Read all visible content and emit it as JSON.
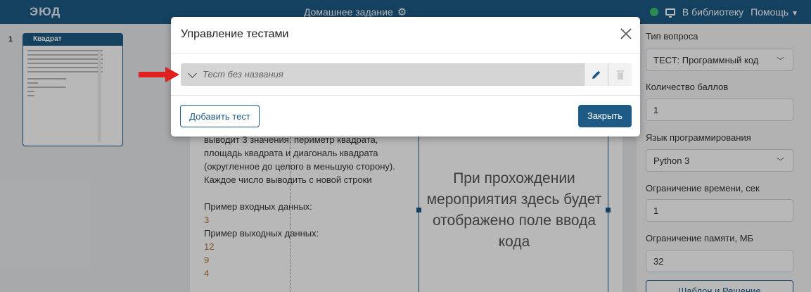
{
  "topbar": {
    "logo": "ЭЮД",
    "title": "Домашнее задание",
    "library_link": "В библиотеку",
    "help_menu": "Помощь"
  },
  "slides": [
    {
      "number": "1",
      "title": "Квадрат"
    }
  ],
  "content": {
    "lines": [
      "выводит 3 значения: периметр квадрата,",
      "площадь квадрата и диагональ квадрата",
      "(округленное до целого в меньшую сторону).",
      "Каждое число выводить с новой строки"
    ],
    "input_example_label": "Пример входных данных:",
    "input_example": "3",
    "output_example_label": "Пример выходных данных:",
    "output_example": [
      "12",
      "9",
      "4"
    ],
    "code_placeholder": "При прохождении мероприятия здесь будет отображено поле ввода кода"
  },
  "settings": {
    "question_type_label": "Тип вопроса",
    "question_type_value": "ТЕСТ: Программный код",
    "points_label": "Количество баллов",
    "points_value": "1",
    "language_label": "Язык программирования",
    "language_value": "Python 3",
    "time_limit_label": "Ограничение времени, сек",
    "time_limit_value": "1",
    "memory_limit_label": "Ограничение памяти, МБ",
    "memory_limit_value": "32",
    "template_button": "Шаблон и Решение"
  },
  "modal": {
    "title": "Управление тестами",
    "tests": [
      {
        "name": "Тест без названия"
      }
    ],
    "add_test_button": "Добавить тест",
    "close_button": "Закрыть"
  },
  "colors": {
    "brand": "#1e5a86",
    "status_online": "#3ec177",
    "annotation_arrow": "#e02020"
  }
}
